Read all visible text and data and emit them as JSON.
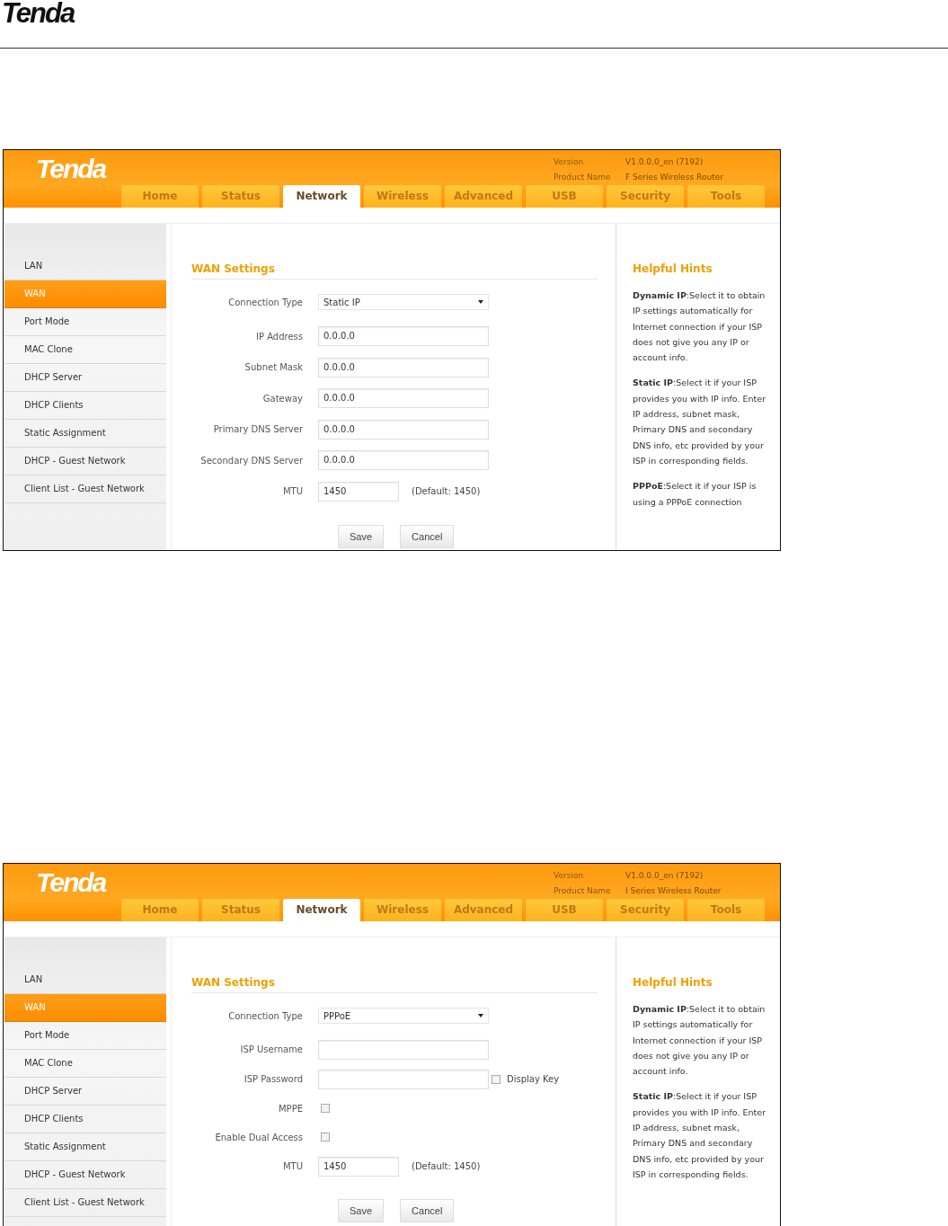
{
  "document": {
    "logo": "Tenda"
  },
  "screenshots": [
    {
      "header": {
        "logo": "Tenda",
        "info": [
          {
            "label": "Version",
            "value": "V1.0.0.0_en (7192)"
          },
          {
            "label": "Product Name",
            "value": "F Series Wireless Router"
          }
        ]
      },
      "tabs": [
        {
          "label": "Home",
          "selected": false
        },
        {
          "label": "Status",
          "selected": false
        },
        {
          "label": "Network",
          "selected": true
        },
        {
          "label": "Wireless",
          "selected": false
        },
        {
          "label": "Advanced",
          "selected": false
        },
        {
          "label": "USB",
          "selected": false
        },
        {
          "label": "Security",
          "selected": false
        },
        {
          "label": "Tools",
          "selected": false
        }
      ],
      "sidebar": {
        "items": [
          {
            "label": "LAN",
            "selected": false
          },
          {
            "label": "WAN",
            "selected": true
          },
          {
            "label": "Port Mode",
            "selected": false
          },
          {
            "label": "MAC Clone",
            "selected": false
          },
          {
            "label": "DHCP Server",
            "selected": false
          },
          {
            "label": "DHCP Clients",
            "selected": false
          },
          {
            "label": "Static Assignment",
            "selected": false
          },
          {
            "label": "DHCP - Guest Network",
            "selected": false
          },
          {
            "label": "Client List - Guest Network",
            "selected": false
          }
        ]
      },
      "form": {
        "title": "WAN Settings",
        "fields": [
          {
            "kind": "select",
            "label": "Connection Type",
            "value": "Static IP"
          },
          {
            "kind": "text",
            "label": "IP Address",
            "value": "0.0.0.0"
          },
          {
            "kind": "text",
            "label": "Subnet Mask",
            "value": "0.0.0.0"
          },
          {
            "kind": "text",
            "label": "Gateway",
            "value": "0.0.0.0"
          },
          {
            "kind": "text",
            "label": "Primary DNS Server",
            "value": "0.0.0.0"
          },
          {
            "kind": "text",
            "label": "Secondary DNS Server",
            "value": "0.0.0.0"
          },
          {
            "kind": "short",
            "label": "MTU",
            "value": "1450",
            "note": "(Default: 1450)"
          }
        ],
        "buttons": [
          "Save",
          "Cancel"
        ]
      },
      "hints": {
        "title": "Helpful Hints",
        "paragraphs": [
          "**Dynamic IP**:Select it to obtain IP settings automatically for Internet connection if your ISP does not give you any IP or account info.",
          "**Static IP**:Select it if your ISP provides you with IP info. Enter IP address, subnet mask, Primary DNS and secondary DNS info, etc provided by your ISP in corresponding fields.",
          "**PPPoE**:Select it if your ISP is using a PPPoE connection"
        ]
      }
    },
    {
      "header": {
        "logo": "Tenda",
        "info": [
          {
            "label": "Version",
            "value": "V1.0.0.0_en (7192)"
          },
          {
            "label": "Product Name",
            "value": "I Series Wireless Router"
          }
        ]
      },
      "tabs": [
        {
          "label": "Home",
          "selected": false
        },
        {
          "label": "Status",
          "selected": false
        },
        {
          "label": "Network",
          "selected": true
        },
        {
          "label": "Wireless",
          "selected": false
        },
        {
          "label": "Advanced",
          "selected": false
        },
        {
          "label": "USB",
          "selected": false
        },
        {
          "label": "Security",
          "selected": false
        },
        {
          "label": "Tools",
          "selected": false
        }
      ],
      "sidebar": {
        "items": [
          {
            "label": "LAN",
            "selected": false
          },
          {
            "label": "WAN",
            "selected": true
          },
          {
            "label": "Port Mode",
            "selected": false
          },
          {
            "label": "MAC Clone",
            "selected": false
          },
          {
            "label": "DHCP Server",
            "selected": false
          },
          {
            "label": "DHCP Clients",
            "selected": false
          },
          {
            "label": "Static Assignment",
            "selected": false
          },
          {
            "label": "DHCP - Guest Network",
            "selected": false
          },
          {
            "label": "Client List - Guest Network",
            "selected": false
          }
        ]
      },
      "form": {
        "title": "WAN Settings",
        "fields": [
          {
            "kind": "select",
            "label": "Connection Type",
            "value": "PPPoE"
          },
          {
            "kind": "text",
            "label": "ISP Username"
          },
          {
            "kind": "password",
            "label": "ISP Password",
            "option": {
              "label": "Display Key",
              "checked": false
            }
          },
          {
            "kind": "checkbox",
            "label": "MPPE",
            "checked": false
          },
          {
            "kind": "checkbox",
            "label": "Enable Dual Access",
            "checked": false
          },
          {
            "kind": "short",
            "label": "MTU",
            "value": "1450",
            "note": "(Default: 1450)"
          }
        ],
        "buttons": [
          "Save",
          "Cancel"
        ]
      },
      "hints": {
        "title": "Helpful Hints",
        "paragraphs": [
          "**Dynamic IP**:Select it to obtain IP settings automatically for Internet connection if your ISP does not give you any IP or account info.",
          "**Static IP**:Select it if your ISP provides you with IP info. Enter IP address, subnet mask, Primary DNS and secondary DNS info, etc provided by your ISP in corresponding fields."
        ]
      }
    }
  ]
}
